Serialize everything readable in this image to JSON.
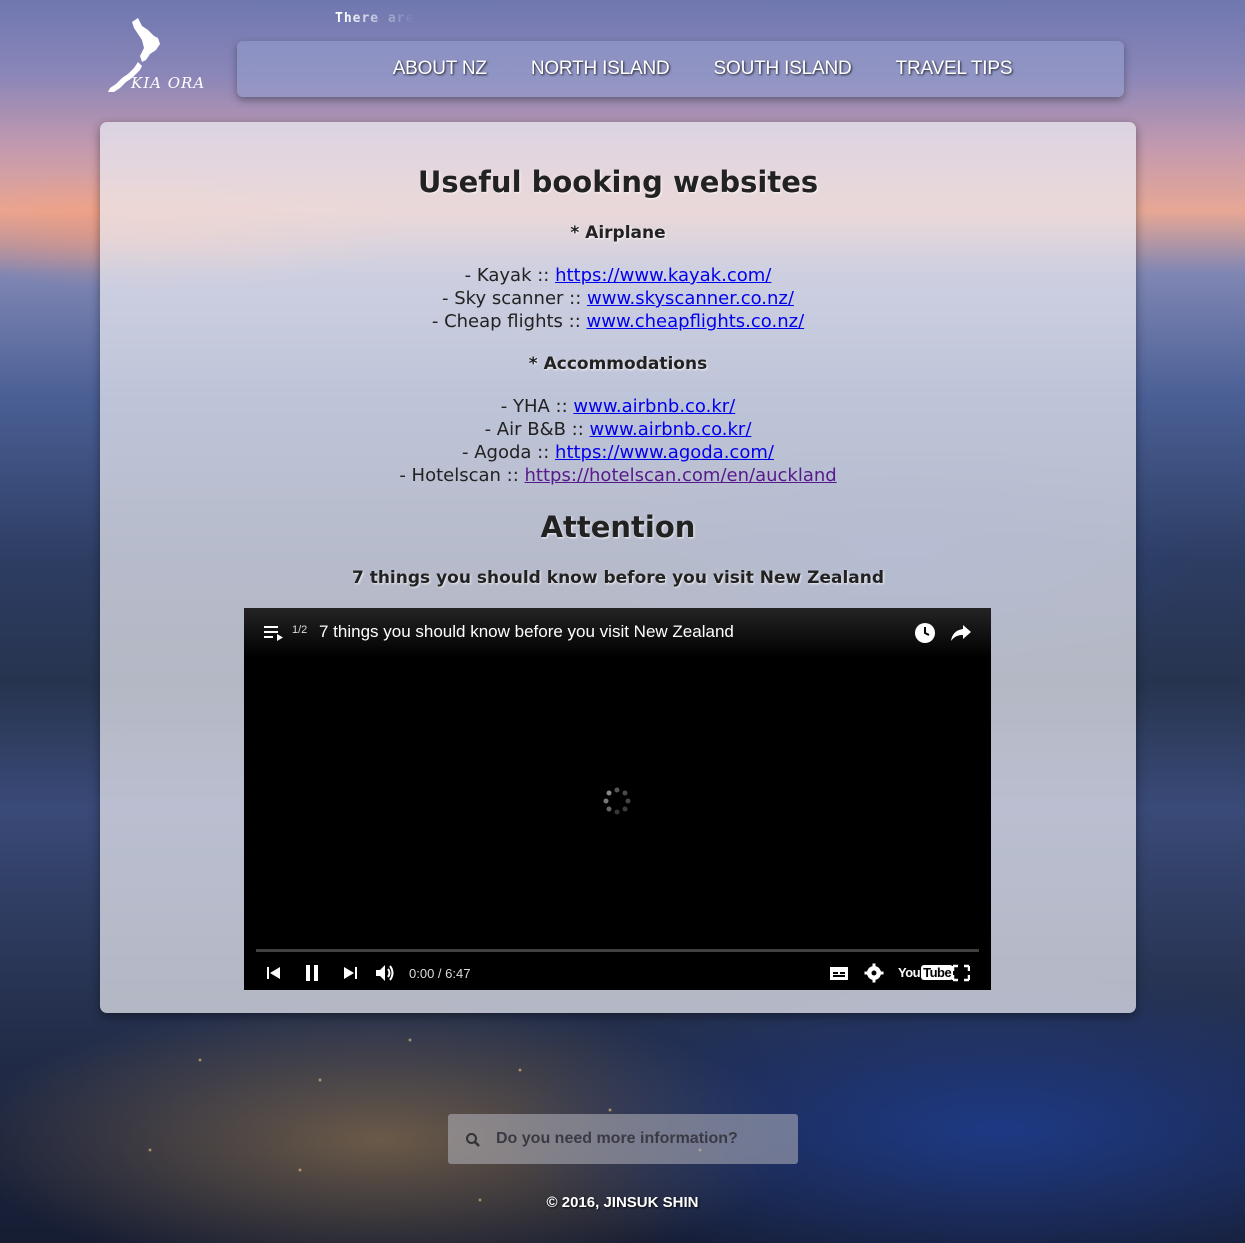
{
  "header": {
    "logo_text": "KIA ORA",
    "ticker": "There are",
    "nav": [
      "ABOUT NZ",
      "NORTH ISLAND",
      "SOUTH ISLAND",
      "TRAVEL TIPS"
    ]
  },
  "main": {
    "heading": "Useful booking websites",
    "airplane": {
      "label": "* Airplane",
      "items": [
        {
          "prefix": "- Kayak :: ",
          "link": "https://www.kayak.com/"
        },
        {
          "prefix": "- Sky scanner :: ",
          "link": "www.skyscanner.co.nz/"
        },
        {
          "prefix": "- Cheap flights :: ",
          "link": "www.cheapflights.co.nz/"
        }
      ]
    },
    "accommodations": {
      "label": "* Accommodations",
      "items": [
        {
          "prefix": "- YHA :: ",
          "link": "www.airbnb.co.kr/"
        },
        {
          "prefix": "- Air B&B :: ",
          "link": "www.airbnb.co.kr/"
        },
        {
          "prefix": "- Agoda :: ",
          "link": "https://www.agoda.com/"
        },
        {
          "prefix": "- Hotelscan :: ",
          "link": "https://hotelscan.com/en/auckland"
        }
      ]
    },
    "attention_heading": "Attention",
    "video_caption": "7 things you should know before you visit New Zealand"
  },
  "player": {
    "playlist_count": "1/2",
    "title": "7 things you should know before you visit New Zealand",
    "time": "0:00 / 6:47",
    "logo_you": "You",
    "logo_tube": "Tube"
  },
  "search": {
    "placeholder": "Do you need more information?"
  },
  "footer": {
    "copyright": "© 2016, JINSUK SHIN"
  },
  "colors": {
    "link": "#0000ee",
    "visited_link": "#551a8b"
  }
}
